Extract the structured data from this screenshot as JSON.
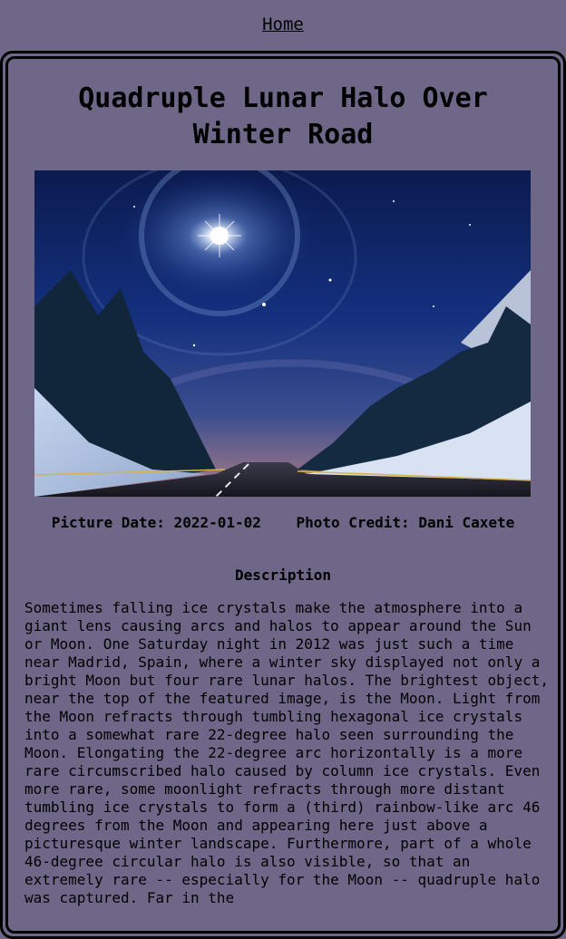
{
  "nav": {
    "home_label": "Home"
  },
  "article": {
    "title": "Quadruple Lunar Halo Over Winter Road",
    "image_alt": "",
    "picture_date_label": "Picture Date:",
    "picture_date": "2022-01-02",
    "photo_credit_label": "Photo Credit:",
    "photo_credit": "Dani Caxete",
    "description_heading": "Description",
    "description": "Sometimes falling ice crystals make the atmosphere into a giant lens causing arcs and halos to appear around the Sun or Moon. One Saturday night in 2012 was just such a time near Madrid, Spain, where a winter sky displayed not only a bright Moon but four rare lunar halos. The brightest object, near the top of the featured image, is the Moon. Light from the Moon refracts through tumbling hexagonal ice crystals into a somewhat rare 22-degree halo seen surrounding the Moon. Elongating the 22-degree arc horizontally is a more rare circumscribed halo caused by column ice crystals. Even more rare, some moonlight refracts through more distant tumbling ice crystals to form a (third) rainbow-like arc 46 degrees from the Moon and appearing here just above a picturesque winter landscape. Furthermore, part of a whole 46-degree circular halo is also visible, so that an extremely rare -- especially for the Moon -- quadruple halo was captured. Far in the"
  },
  "colors": {
    "background": "#6e6787",
    "border": "#000000",
    "text": "#000000"
  }
}
